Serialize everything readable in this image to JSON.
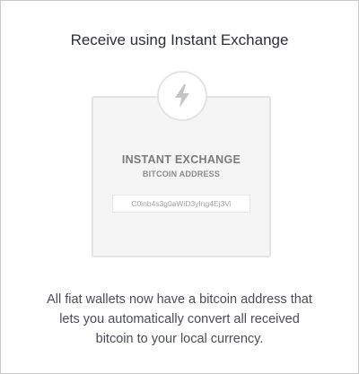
{
  "dialog": {
    "title": "Receive using Instant Exchange",
    "description_lines": [
      "All fiat wallets now have a bitcoin address that",
      "lets you automatically convert all received",
      "bitcoin to your local currency."
    ]
  },
  "card": {
    "icon": "lightning-bolt-icon",
    "heading": "INSTANT EXCHANGE",
    "subheading": "BITCOIN ADDRESS",
    "address": "C0inb4s3g0aWiD3yIng4Ej3Vi"
  },
  "colors": {
    "border": "#c9c9c9",
    "card_background": "#f5f5f5",
    "card_border": "#e3e3e3",
    "icon": "#c4c4c4",
    "title_text": "#2b2f38",
    "body_text": "#4a4d55"
  }
}
